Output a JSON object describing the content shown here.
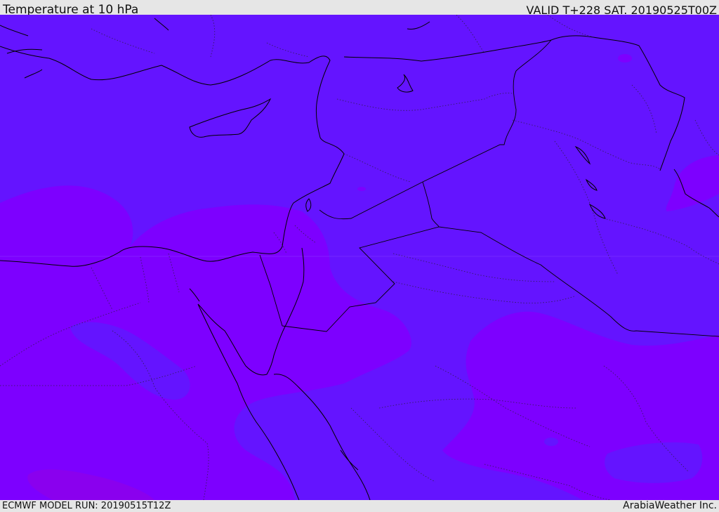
{
  "header": {
    "title": "Temperature at 10 hPa",
    "valid": "VALID T+228 SAT. 20190525T00Z"
  },
  "footer": {
    "model_run": "ECMWF MODEL RUN: 20190515T12Z",
    "credit": "ArabiaWeather Inc."
  },
  "map": {
    "field": "temperature",
    "level": "10 hPa",
    "colors": {
      "cooler_band": "#6414ff",
      "warmer_band": "#7d00ff",
      "warmest_patch": "#8a00ee",
      "coastline": "#000000",
      "border": "#000000"
    }
  }
}
